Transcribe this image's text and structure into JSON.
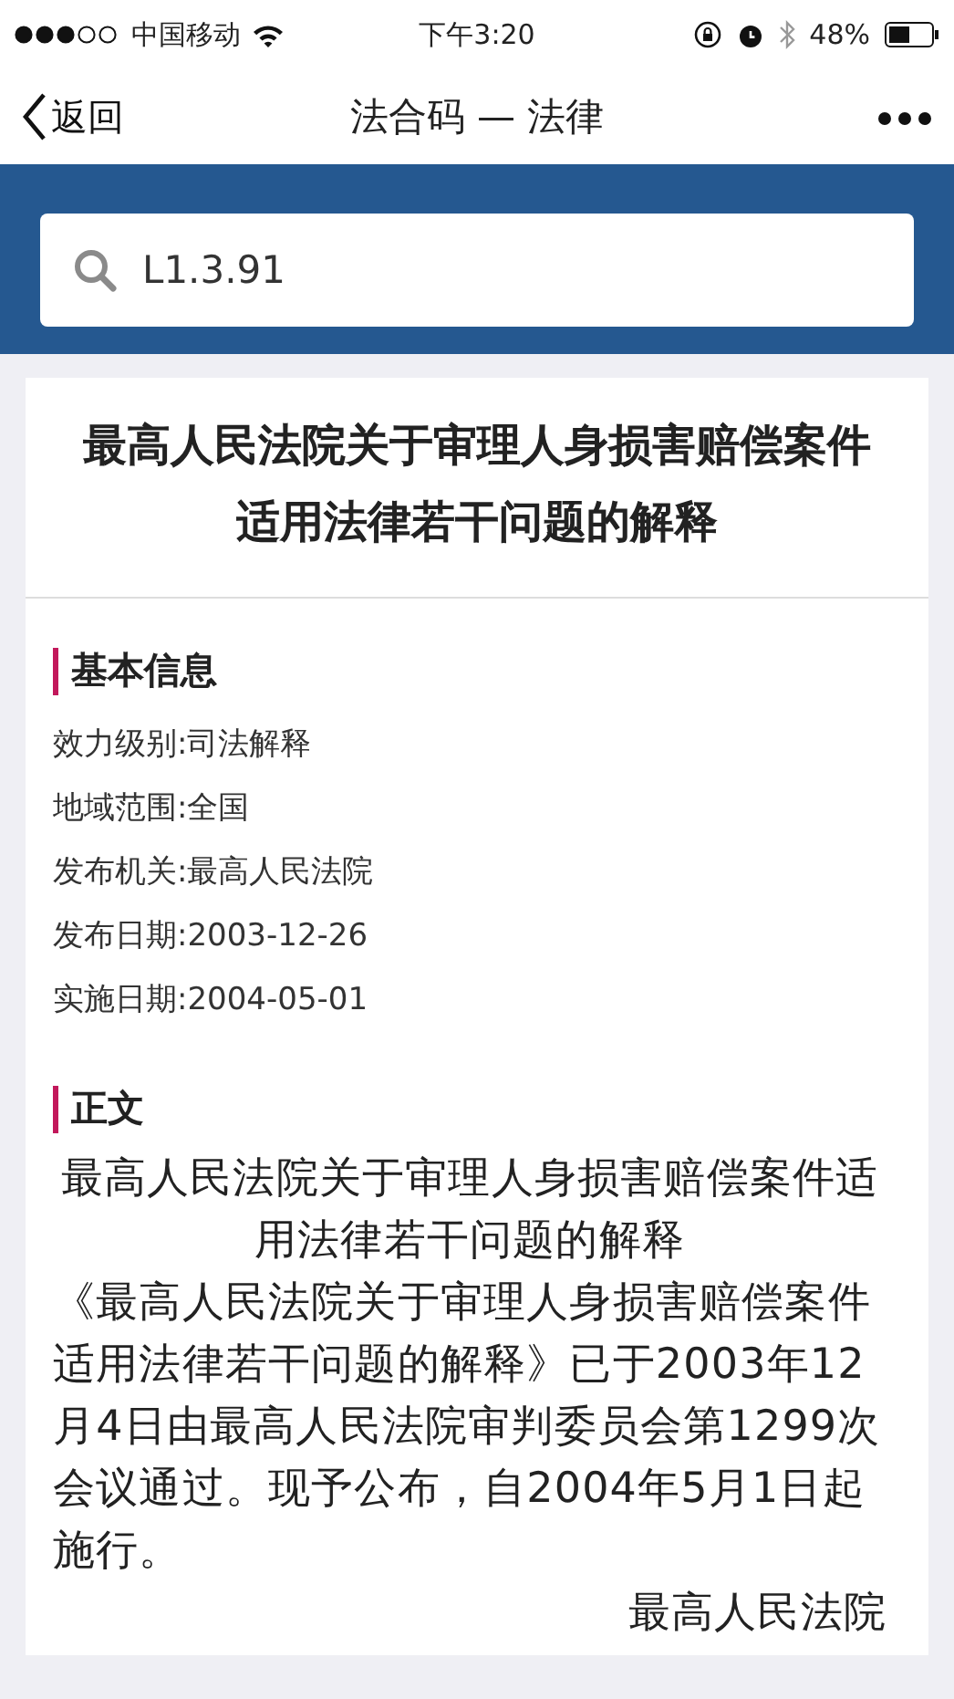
{
  "status_bar": {
    "carrier": "中国移动",
    "time": "下午3:20",
    "battery": "48%"
  },
  "nav": {
    "back": "返回",
    "title": "法合码 — 法律"
  },
  "search": {
    "value": "L1.3.91"
  },
  "law_title": "最高人民法院关于审理人身损害赔偿案件适用法律若干问题的解释",
  "sections": [
    {
      "kind": "info",
      "heading": "基本信息",
      "lines": [
        "效力级别:司法解释",
        "地域范围:全国",
        "发布机关:最高人民法院",
        "发布日期:2003-12-26",
        "实施日期:2004-05-01"
      ]
    },
    {
      "kind": "body",
      "heading": "正文",
      "paragraphs": [
        {
          "text": "最高人民法院关于审理人身损害赔偿案件适用法律若干问题的解释",
          "kind": "heading"
        },
        {
          "text": "《最高人民法院关于审理人身损害赔偿案件适用法律若干问题的解释》已于2003年12月4日由最高人民法院审判委员会第1299次会议通过。现予公布，自2004年5月1日起施行。",
          "kind": "text"
        },
        {
          "text": "最高人民法院",
          "kind": "signature"
        }
      ]
    }
  ]
}
